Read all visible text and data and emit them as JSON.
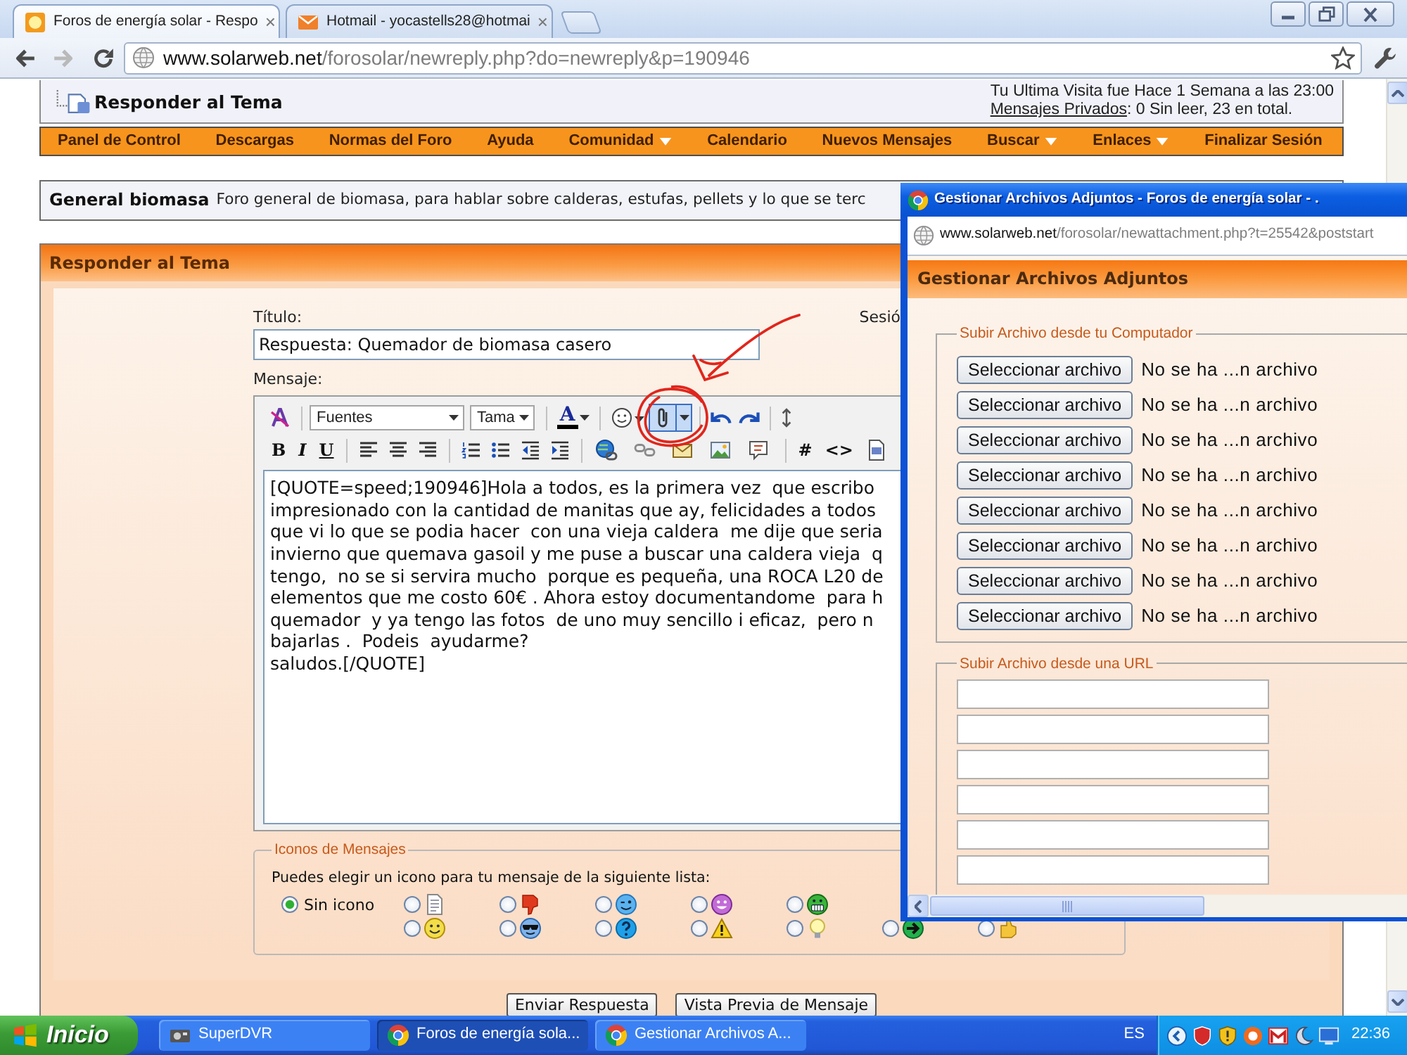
{
  "browser": {
    "tabs": [
      {
        "title": "Foros de energía solar - Respo",
        "close": "×",
        "kind": "sun",
        "selected": true
      },
      {
        "title": "Hotmail - yocastells28@hotmai",
        "close": "×",
        "kind": "mail",
        "selected": false
      }
    ],
    "nav_buttons": [
      {
        "kind": "back",
        "disabled": false
      },
      {
        "kind": "forward",
        "disabled": true
      },
      {
        "kind": "reload",
        "disabled": false
      }
    ],
    "url": {
      "host": "www.solarweb.net",
      "path": "/forosolar/newreply.php?do=newreply&p=190946"
    }
  },
  "page": {
    "header": {
      "title": "Responder al Tema",
      "last_visit": "Tu Ultima Visita fue Hace 1 Semana a las 23:00",
      "private_messages_link": "Mensajes Privados",
      "private_messages_text": ": 0 Sin leer, 23 en total."
    },
    "navbar": [
      {
        "label": "Panel de Control",
        "dropdown": false
      },
      {
        "label": "Descargas",
        "dropdown": false
      },
      {
        "label": "Normas del Foro",
        "dropdown": false
      },
      {
        "label": "Ayuda",
        "dropdown": false
      },
      {
        "label": "Comunidad",
        "dropdown": true
      },
      {
        "label": "Calendario",
        "dropdown": false
      },
      {
        "label": "Nuevos Mensajes",
        "dropdown": false
      },
      {
        "label": "Buscar",
        "dropdown": true
      },
      {
        "label": "Enlaces",
        "dropdown": true
      },
      {
        "label": "Finalizar Sesión",
        "dropdown": false
      }
    ],
    "forum": {
      "name": "General biomasa",
      "description": "Foro general de biomasa, para hablar sobre calderas, estufas, pellets y lo que se terc"
    },
    "reply": {
      "title": "Responder al Tema",
      "title_label": "Título:",
      "title_value": "Respuesta: Quemador de biomasa casero",
      "session_label": "Sesió",
      "message_label": "Mensaje:",
      "toolbar": [
        [
          [
            {
              "kind": "remove-format",
              "highlighted": false
            }
          ],
          [
            {
              "kind": "select",
              "value": "Fuentes",
              "highlighted": false
            },
            {
              "kind": "select",
              "value": "Tama",
              "highlighted": false
            }
          ],
          [
            {
              "kind": "text-color",
              "label": "A",
              "highlighted": false
            }
          ],
          [
            {
              "kind": "smilies",
              "highlighted": false
            },
            {
              "kind": "attach",
              "highlighted": true
            }
          ],
          [
            {
              "kind": "undo",
              "highlighted": false
            },
            {
              "kind": "redo",
              "highlighted": false
            }
          ],
          [
            {
              "kind": "resize",
              "highlighted": false
            }
          ]
        ],
        [
          [
            {
              "kind": "bold",
              "label": "B",
              "highlighted": false
            },
            {
              "kind": "italic",
              "label": "I",
              "highlighted": false
            },
            {
              "kind": "underline",
              "label": "U",
              "highlighted": false
            }
          ],
          [
            {
              "kind": "align-left",
              "highlighted": false
            },
            {
              "kind": "align-center",
              "highlighted": false
            },
            {
              "kind": "align-right",
              "highlighted": false
            }
          ],
          [
            {
              "kind": "ordered-list",
              "highlighted": false
            },
            {
              "kind": "unordered-list",
              "highlighted": false
            },
            {
              "kind": "outdent",
              "highlighted": false
            },
            {
              "kind": "indent",
              "highlighted": false
            }
          ],
          [
            {
              "kind": "link",
              "highlighted": false
            },
            {
              "kind": "unlink",
              "highlighted": false
            },
            {
              "kind": "email",
              "highlighted": false
            },
            {
              "kind": "image",
              "highlighted": false
            },
            {
              "kind": "quote",
              "highlighted": false
            }
          ],
          [
            {
              "kind": "code",
              "label": "#",
              "highlighted": false
            },
            {
              "kind": "html",
              "label": "<>",
              "highlighted": false
            },
            {
              "kind": "php",
              "highlighted": false
            }
          ]
        ]
      ],
      "message_lines": [
        "[QUOTE=speed;190946]Hola a todos, es la primera vez  que escribo",
        "impresionado con la cantidad de manitas que ay, felicidades a todos",
        "que vi lo que se podia hacer  con una vieja caldera  me dije que seria",
        "invierno que quemava gasoil y me puse a buscar una caldera vieja  q",
        "tengo,  no se si servira mucho  porque es pequeña, una ROCA L20 de",
        "elementos que me costo 60€ . Ahora estoy documentandome  para h",
        "quemador  y ya tengo las fotos  de uno muy sencillo i eficaz,  pero n",
        "bajarlas .  Podeis  ayudarme?",
        "saludos.[/QUOTE]"
      ],
      "annotations": {
        "arrow": true,
        "circle": true
      },
      "icons_legend": "Iconos de Mensajes",
      "icons_hint": "Puedes elegir un icono para tu mensaje de la siguiente lista:",
      "icon_rows": [
        [
          {
            "kind": "none",
            "label": "Sin icono",
            "selected": true
          },
          {
            "kind": "document",
            "selected": false
          },
          {
            "kind": "thumbs-down",
            "selected": false
          },
          {
            "kind": "wink",
            "selected": false
          },
          {
            "kind": "purple-face",
            "selected": false
          },
          {
            "kind": "grin",
            "selected": false
          }
        ],
        [
          {
            "kind": "smile",
            "selected": false
          },
          {
            "kind": "cool",
            "selected": false
          },
          {
            "kind": "question",
            "selected": false
          },
          {
            "kind": "warning",
            "selected": false
          },
          {
            "kind": "bulb",
            "selected": false
          },
          {
            "kind": "arrow",
            "selected": false
          },
          {
            "kind": "thumbs-up",
            "selected": false
          }
        ]
      ],
      "buttons": [
        "Enviar Respuesta",
        "Vista Previa de Mensaje"
      ]
    }
  },
  "popup": {
    "title": "Gestionar Archivos Adjuntos - Foros de energía solar - .",
    "url": {
      "host": "www.solarweb.net",
      "path": "/forosolar/newattachment.php?t=25542&poststart"
    },
    "heading": "Gestionar Archivos Adjuntos",
    "upload_legend": "Subir Archivo desde tu Computador",
    "file_rows": [
      {
        "button": "Seleccionar archivo",
        "status": "No se ha ...n archivo"
      },
      {
        "button": "Seleccionar archivo",
        "status": "No se ha ...n archivo"
      },
      {
        "button": "Seleccionar archivo",
        "status": "No se ha ...n archivo"
      },
      {
        "button": "Seleccionar archivo",
        "status": "No se ha ...n archivo"
      },
      {
        "button": "Seleccionar archivo",
        "status": "No se ha ...n archivo"
      },
      {
        "button": "Seleccionar archivo",
        "status": "No se ha ...n archivo"
      },
      {
        "button": "Seleccionar archivo",
        "status": "No se ha ...n archivo"
      },
      {
        "button": "Seleccionar archivo",
        "status": "No se ha ...n archivo"
      }
    ],
    "url_legend": "Subir Archivo desde una URL",
    "url_fields": [
      {
        "kind": "text-input"
      },
      {
        "kind": "text-input"
      },
      {
        "kind": "text-input"
      },
      {
        "kind": "text-input"
      },
      {
        "kind": "text-input"
      },
      {
        "kind": "text-input"
      }
    ]
  },
  "taskbar": {
    "start": "Inicio",
    "tasks": [
      {
        "label": "SuperDVR",
        "kind": "dvr",
        "selected": false
      },
      {
        "label": "Foros de energía sola...",
        "kind": "chrome",
        "selected": true
      },
      {
        "label": "Gestionar Archivos A...",
        "kind": "chrome",
        "selected": false
      }
    ],
    "language": "ES",
    "clock": "22:36"
  }
}
